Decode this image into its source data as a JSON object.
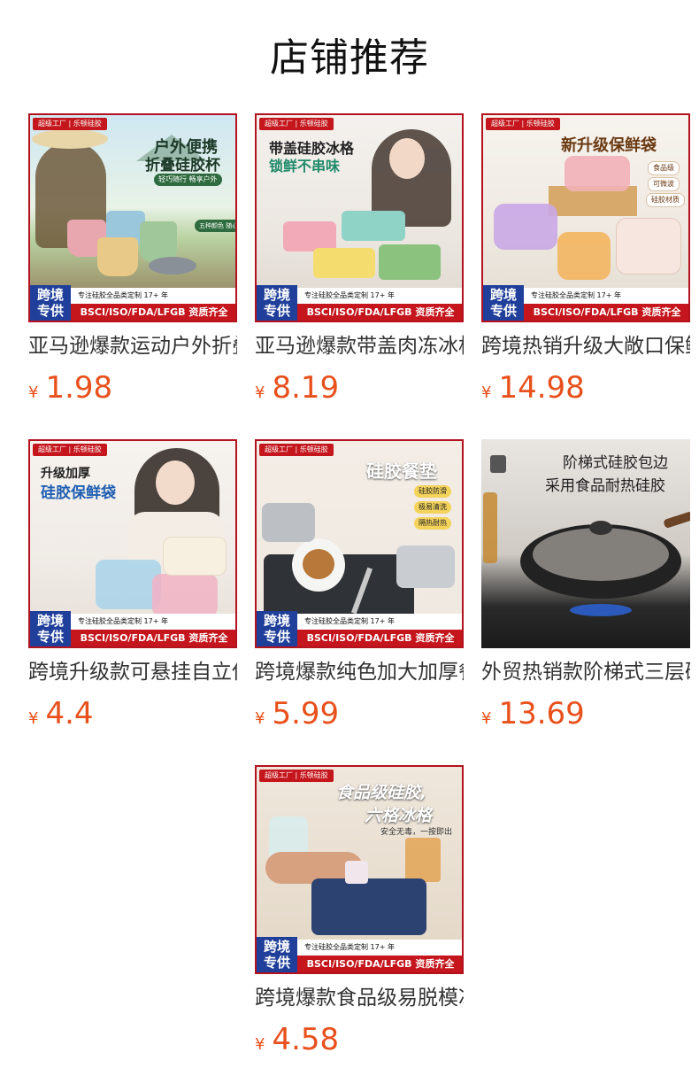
{
  "page": {
    "title": "店铺推荐"
  },
  "common": {
    "badge": "超级工厂 | 乐顿硅胶",
    "ribbon_left": "跨境\n专供",
    "ribbon_top": "专注硅胶全品类定制 17+ 年",
    "ribbon_cert": "BSCI/ISO/FDA/LFGB 资质齐全",
    "currency": "¥"
  },
  "products": [
    {
      "title": "亚马逊爆款运动户外折叠硅胶杯",
      "price": "1.98",
      "image": {
        "headline1": "户外便携",
        "headline2": "折叠硅胶杯",
        "tagline": "轻巧随行 畅享户外",
        "chip": "五种颜色 随心选择"
      }
    },
    {
      "title": "亚马逊爆款带盖肉冻冰格",
      "price": "8.19",
      "image": {
        "headline1": "带盖硅胶冰格",
        "headline2": "锁鲜不串味"
      }
    },
    {
      "title": "跨境热销升级大敞口保鲜袋",
      "price": "14.98",
      "image": {
        "headline1": "新升级保鲜袋",
        "chips": [
          "食品级",
          "可微波",
          "硅胶材质"
        ]
      }
    },
    {
      "title": "跨境升级款可悬挂自立保鲜袋",
      "price": "4.4",
      "image": {
        "headline1": "升级加厚",
        "headline2": "硅胶保鲜袋"
      }
    },
    {
      "title": "跨境爆款纯色加大加厚餐垫",
      "price": "5.99",
      "image": {
        "headline1": "硅胶餐垫",
        "chips": [
          "硅胶防滑",
          "极易清洗",
          "隔热耐热"
        ]
      }
    },
    {
      "title": "外贸热销款阶梯式三层硅胶锅盖",
      "price": "13.69",
      "image": {
        "headline1": "阶梯式硅胶包边",
        "headline2": "采用食品耐热硅胶"
      }
    },
    {
      "title": "跨境爆款食品级易脱模冰格",
      "price": "4.58",
      "image": {
        "headline1": "食品级硅胶,",
        "headline2": "六格冰格",
        "tagline": "安全无毒，一按即出"
      }
    }
  ]
}
